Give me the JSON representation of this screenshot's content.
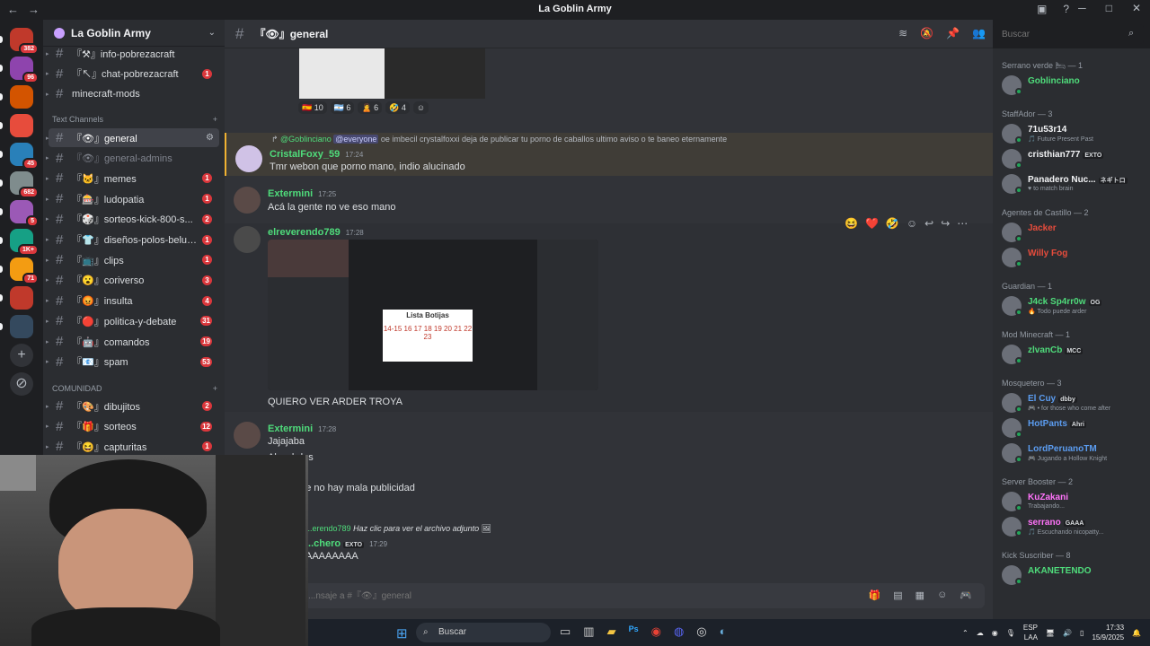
{
  "window": {
    "title": "La Goblin Army",
    "nav_back": "←",
    "nav_forward": "→",
    "minimize": "─",
    "maximize": "□",
    "close": "✕"
  },
  "servers": [
    {
      "badge": "382",
      "color": "#c0392b"
    },
    {
      "badge": "96",
      "color": "#8e44ad"
    },
    {
      "badge": "",
      "color": "#d35400"
    },
    {
      "badge": "",
      "color": "#e74c3c"
    },
    {
      "badge": "45",
      "color": "#2980b9"
    },
    {
      "badge": "682",
      "color": "#7f8c8d"
    },
    {
      "badge": "5",
      "color": "#9b59b6"
    },
    {
      "badge": "1K+",
      "color": "#16a085"
    },
    {
      "badge": "71",
      "color": "#f39c12"
    },
    {
      "badge": "",
      "color": "#c0392b"
    },
    {
      "badge": "",
      "color": "#34495e"
    }
  ],
  "server_actions": {
    "add": "+",
    "discover": "⊘"
  },
  "guild": {
    "name": "La Goblin Army",
    "chevron": "⌄"
  },
  "channels_top": [
    {
      "name": "『⚒』info-pobrezacraft",
      "count": ""
    },
    {
      "name": "『↖』chat-pobrezacraft",
      "count": "1"
    },
    {
      "name": "minecraft-mods",
      "count": ""
    }
  ],
  "categories": {
    "text": "Text Channels",
    "comunidad": "COMUNIDAD",
    "add": "+"
  },
  "channels_text": [
    {
      "name": "『👁』general",
      "count": "",
      "active": true
    },
    {
      "name": "『👁』general-admins",
      "count": "",
      "muted": true
    },
    {
      "name": "『🐱』memes",
      "count": "1"
    },
    {
      "name": "『🎰』ludopatia",
      "count": "1"
    },
    {
      "name": "『🎲』sorteos-kick-800-s...",
      "count": "2"
    },
    {
      "name": "『👕』diseños-polos-beluga-ar...",
      "count": "1"
    },
    {
      "name": "『📺』clips",
      "count": "1"
    },
    {
      "name": "『😮』coriverso",
      "count": "3"
    },
    {
      "name": "『😡』insulta",
      "count": "4"
    },
    {
      "name": "『🔴』politica-y-debate",
      "count": "31"
    },
    {
      "name": "『🤖』comandos",
      "count": "19"
    },
    {
      "name": "『📧』spam",
      "count": "53"
    }
  ],
  "channels_comunidad": [
    {
      "name": "『🎨』dibujitos",
      "count": "2"
    },
    {
      "name": "『🎁』sorteos",
      "count": "12"
    },
    {
      "name": "『😆』capturitas",
      "count": "1"
    }
  ],
  "header": {
    "channel": "『👁』general"
  },
  "search": {
    "placeholder": "Buscar"
  },
  "messages": {
    "reactions": [
      "🇪🇸 10",
      "🇦🇷 6",
      "🙎 6",
      "🤣 4",
      "☺"
    ],
    "m1": {
      "reply_author": "@Goblinciano",
      "reply_mention": "@everyone",
      "reply_text": "oe imbecil crystalfoxxi deja de publicar tu porno de caballos ultimo aviso o te baneo eternamente",
      "author": "CristalFoxy_59",
      "time": "17:24",
      "text": "Tmr webon que porno mano, indio alucinado"
    },
    "m2": {
      "author": "Extermini",
      "time": "17:25",
      "text": "Acá la gente no ve eso mano"
    },
    "m3": {
      "author": "elreverendo789",
      "time": "17:28",
      "caption": "QUIERO VER ARDER TROYA",
      "image_text": "Lista Botijas",
      "image_nums": "14-15 16 17 18 19 20 21 22 23"
    },
    "m4": {
      "author": "Extermini",
      "time": "17:28",
      "line1": "Jajajaba",
      "line2": "Ale wbdes",
      "line3": "...cen que no hay mala publicidad"
    },
    "m5": {
      "reply_author": "...erendo789",
      "reply_text": "Haz clic para ver el archivo adjunto",
      "author": "...chero",
      "tag": "EXTO",
      "time": "17:29",
      "text": "AAAAAAAA"
    }
  },
  "hover_actions": [
    "😆",
    "❤️",
    "🤣",
    "☺",
    "↩",
    "↪",
    "⋯"
  ],
  "composer": {
    "placeholder": "...nsaje a #『👁』general"
  },
  "members": {
    "groups": [
      {
        "title": "Serrano verde 🛏 — 1",
        "items": [
          {
            "name": "Goblinciano",
            "color": "#4fdc7b",
            "sub": "",
            "tag": ""
          }
        ]
      },
      {
        "title": "StaffAdor — 3",
        "items": [
          {
            "name": "71u53r14",
            "color": "#f2f3f5",
            "sub": "🎵 Future Present Past",
            "tag": ""
          },
          {
            "name": "cristhian777",
            "color": "#f2f3f5",
            "sub": "",
            "tag": "EXTO"
          },
          {
            "name": "Panadero Nuc...",
            "color": "#f2f3f5",
            "sub": "♥ to match brain",
            "tag": "ネギトロ"
          }
        ]
      },
      {
        "title": "Agentes de Castillo — 2",
        "items": [
          {
            "name": "Jacker",
            "color": "#e74c3c",
            "sub": "",
            "tag": ""
          },
          {
            "name": "Willy Fog",
            "color": "#e74c3c",
            "sub": "",
            "tag": ""
          }
        ]
      },
      {
        "title": "Guardian — 1",
        "items": [
          {
            "name": "J4ck Sp4rr0w",
            "color": "#4fdc7b",
            "sub": "🔥 Todo puede arder",
            "tag": "OG"
          }
        ]
      },
      {
        "title": "Mod Minecraft — 1",
        "items": [
          {
            "name": "zlvanCb",
            "color": "#4fdc7b",
            "sub": "",
            "tag": "MCC"
          }
        ]
      },
      {
        "title": "Mosquetero — 3",
        "items": [
          {
            "name": "El Cuy",
            "color": "#5b9cf0",
            "sub": "🎮 • for those who come after",
            "tag": "dbby"
          },
          {
            "name": "HotPants",
            "color": "#5b9cf0",
            "sub": "",
            "tag": "Ahri"
          },
          {
            "name": "LordPeruanoTM",
            "color": "#5b9cf0",
            "sub": "🎮 Jugando a Hollow Knight",
            "tag": ""
          }
        ]
      },
      {
        "title": "Server Booster — 2",
        "items": [
          {
            "name": "KuZakani",
            "color": "#ff73fa",
            "sub": "Trabajando...",
            "tag": ""
          },
          {
            "name": "serrano",
            "color": "#ff73fa",
            "sub": "🎵 Escuchando nicopatty...",
            "tag": "GAAA"
          }
        ]
      },
      {
        "title": "Kick Suscriber — 8",
        "items": [
          {
            "name": "AKANETENDO",
            "color": "#4fdc7b",
            "sub": "",
            "tag": ""
          }
        ]
      }
    ]
  },
  "taskbar": {
    "search": "Buscar",
    "lang1": "ESP",
    "lang2": "LAA",
    "time": "17:33",
    "date": "15/9/2025"
  }
}
